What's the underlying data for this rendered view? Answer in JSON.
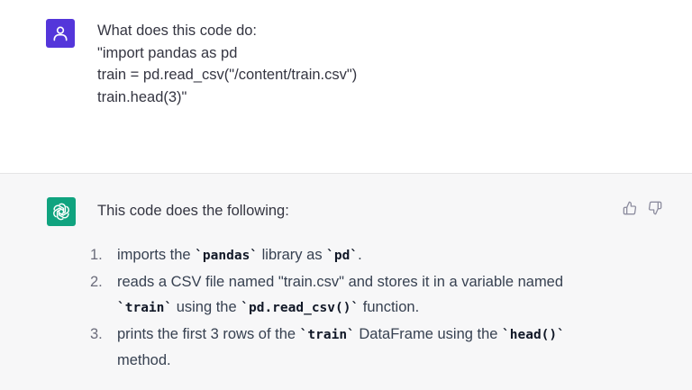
{
  "user_message": {
    "lines": [
      "What does this code do:",
      "\"import pandas as pd",
      "",
      "train = pd.read_csv(\"/content/train.csv\")",
      "",
      "train.head(3)\""
    ]
  },
  "assistant_message": {
    "intro": "This code does the following:",
    "steps": [
      {
        "number": "1.",
        "parts": [
          "imports the ",
          "`pandas`",
          " library as ",
          "`pd`",
          "."
        ]
      },
      {
        "number": "2.",
        "parts": [
          "reads a CSV file named \"train.csv\" and stores it in a variable named ",
          "`train`",
          " using the ",
          "`pd.read_csv()`",
          " function."
        ]
      },
      {
        "number": "3.",
        "parts": [
          "prints the first 3 rows of the ",
          "`train`",
          " DataFrame using the ",
          "`head()`",
          " method."
        ]
      }
    ]
  },
  "icons": {
    "user_avatar": "user-icon",
    "assistant_avatar": "openai-logo-icon",
    "thumbs_up": "thumbs-up-icon",
    "thumbs_down": "thumbs-down-icon"
  },
  "colors": {
    "user_avatar_bg": "#5436da",
    "assistant_avatar_bg": "#10a37f",
    "assistant_block_bg": "#f7f7f8",
    "text": "#343541"
  }
}
